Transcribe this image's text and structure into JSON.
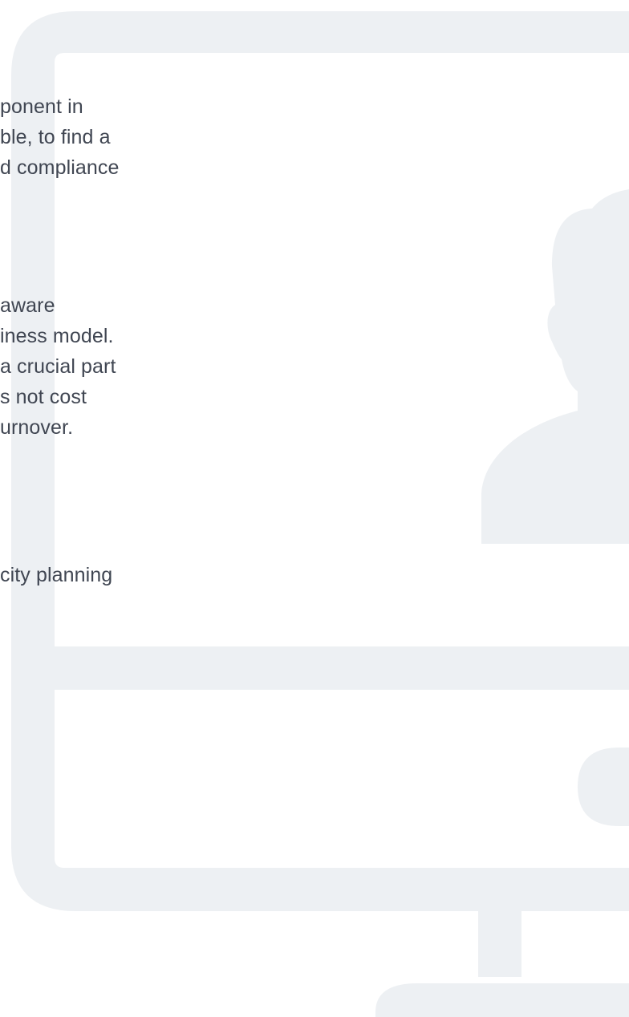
{
  "colors": {
    "background": "#ffffff",
    "illustration_fill": "#edf0f3",
    "text": "#404652"
  },
  "icons": {
    "monitor": "monitor-icon",
    "person": "person-silhouette-icon",
    "webcam": "webcam-dot-icon"
  },
  "paragraphs": [
    {
      "lines": [
        "ponent in",
        "ble, to find a",
        "d compliance"
      ]
    },
    {
      "lines": [
        "aware",
        "iness model.",
        "a crucial part",
        "s not cost",
        "urnover."
      ]
    },
    {
      "lines": [
        "city planning"
      ]
    }
  ]
}
